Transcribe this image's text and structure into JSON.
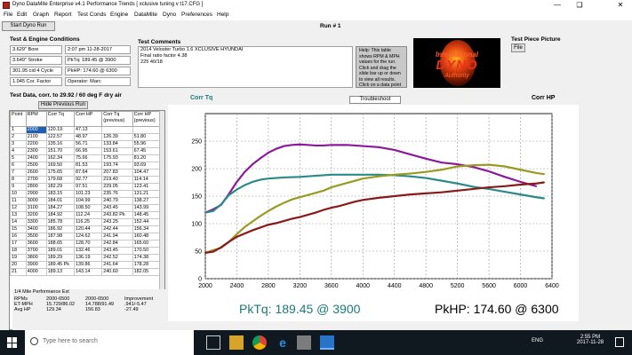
{
  "window": {
    "title": "Dyno DataMite Enterprise v4.1   Performance Trends  [ xclusive tuning v t17.CFG ]"
  },
  "menu": [
    "File",
    "Edit",
    "Graph",
    "Report",
    "Test Conds",
    "Engine",
    "DataMite",
    "Dyno",
    "Preferences",
    "Help"
  ],
  "toolbar": {
    "start_button": "Start Dyno Run",
    "run_label": "Run # 1"
  },
  "engine": {
    "title": "Test & Engine Conditions",
    "bore": "3.629\" Bore",
    "date": "2:07 pm  11-28-2017",
    "stroke": "3.649\" Stroke",
    "pktq": "PkTq: 189.45 @ 3900",
    "displacement": "301.95 cid  4 Cycle",
    "pkhp": "PkHP: 174.60 @ 6300",
    "corr_factor": "1.045 Cor. Factor",
    "operator": "Operator: Marc"
  },
  "comments": {
    "title": "Test Comments",
    "lines": [
      "2014 Veloster Turbo 1.6 XCLUSIVE  HYUNDAI",
      "Final ratio factor 4.38",
      "225 40/18"
    ]
  },
  "help": {
    "text": "Help:  This table shows RPM & MPH values for the run. Click and drag the slide bar up or down to view all results. Click on a data point"
  },
  "logo": {
    "line1": "International",
    "line2": "DYNO",
    "line3": "Authority"
  },
  "test_piece": {
    "title": "Test Piece Picture",
    "button": "File"
  },
  "test_data": {
    "title": "Test Data, corr. to 29.92 / 60 deg F dry air",
    "hide_button": "Hide Previous Run",
    "headers": [
      "Point",
      "RPM",
      "Corr Tq",
      "Corr HP",
      "Corr Tq (previous)",
      "Corr HP (previous)"
    ],
    "rows": [
      [
        "1",
        "2000",
        "120.19",
        "47.13",
        "",
        ""
      ],
      [
        "2",
        "2100",
        "122.57",
        "48.97",
        "126.39",
        "51.80"
      ],
      [
        "3",
        "2200",
        "135.16",
        "56.71",
        "133.84",
        "55.96"
      ],
      [
        "4",
        "2300",
        "151.70",
        "66.95",
        "153.61",
        "67.45"
      ],
      [
        "5",
        "2400",
        "162.34",
        "75.66",
        "175.93",
        "81.20"
      ],
      [
        "6",
        "2500",
        "169.50",
        "81.53",
        "193.74",
        "93.69"
      ],
      [
        "7",
        "2600",
        "175.65",
        "87.64",
        "207.83",
        "104.47"
      ],
      [
        "8",
        "2700",
        "179.68",
        "92.77",
        "219.40",
        "114.14"
      ],
      [
        "9",
        "2800",
        "182.29",
        "97.51",
        "229.05",
        "123.41"
      ],
      [
        "10",
        "2900",
        "183.15",
        "101.23",
        "235.76",
        "131.21"
      ],
      [
        "11",
        "3000",
        "184.01",
        "104.99",
        "240.79",
        "138.27"
      ],
      [
        "12",
        "3100",
        "184.27",
        "108.50",
        "243.45",
        "143.99"
      ],
      [
        "13",
        "3200",
        "184.92",
        "112.24",
        "243.82 Pk",
        "148.45"
      ],
      [
        "14",
        "3300",
        "185.78",
        "116.25",
        "243.25",
        "152.44"
      ],
      [
        "15",
        "3400",
        "186.92",
        "120.44",
        "242.44",
        "156.34"
      ],
      [
        "16",
        "3500",
        "187.98",
        "124.62",
        "241.94",
        "160.48"
      ],
      [
        "17",
        "3600",
        "188.65",
        "128.70",
        "242.84",
        "165.60"
      ],
      [
        "18",
        "3700",
        "189.01",
        "132.46",
        "243.45",
        "170.50"
      ],
      [
        "19",
        "3800",
        "189.29",
        "136.19",
        "242.52",
        "174.38"
      ],
      [
        "20",
        "3900",
        "189.45 Pk",
        "139.86",
        "241.64",
        "178.28"
      ],
      [
        "21",
        "4000",
        "189.13",
        "143.14",
        "240.60",
        "182.05"
      ]
    ]
  },
  "quarter_mile": {
    "title": "1/4 Mile Performance Est",
    "headers": [
      "RPMs",
      "2000-6500",
      "2000-6500",
      "Improvement"
    ],
    "rows": [
      [
        "ET-MPH",
        "15.729/86.02",
        "14.788/91.49",
        ".941/-5.47"
      ],
      [
        "Avg HP",
        "129.34",
        "156.83",
        "-27.49"
      ]
    ]
  },
  "graph": {
    "left_label": "Corr Tq",
    "troubleshoot": "Troubleshoot",
    "right_label": "Corr HP",
    "pktq": "PkTq: 189.45 @ 3900",
    "pkhp": "PkHP: 174.60 @ 6300"
  },
  "chart_data": {
    "type": "line",
    "xlim": [
      2000,
      6400
    ],
    "ylim": [
      0,
      300
    ],
    "x_ticks": [
      2000,
      2400,
      2800,
      3200,
      3600,
      4000,
      4400,
      4800,
      5200,
      5600,
      6000,
      6400
    ],
    "y_ticks": [
      0,
      50,
      100,
      150,
      200,
      250
    ],
    "series": [
      {
        "color": "#8a1a9a",
        "x": [
          2000,
          2100,
          2200,
          2300,
          2400,
          2500,
          2600,
          2700,
          2800,
          2900,
          3000,
          3100,
          3200,
          3300,
          3400,
          3500,
          3600,
          3700,
          3800,
          3900,
          4000,
          4200,
          4400,
          4600,
          4800,
          5000,
          5200,
          5400,
          5600,
          5800,
          6000,
          6200
        ],
        "y": [
          120,
          126,
          134,
          154,
          176,
          194,
          208,
          219,
          229,
          236,
          241,
          243,
          244,
          243,
          242,
          242,
          243,
          243,
          243,
          242,
          241,
          239,
          234,
          226,
          218,
          211,
          208,
          203,
          195,
          185,
          176,
          168
        ]
      },
      {
        "color": "#2a8a8a",
        "x": [
          2000,
          2100,
          2200,
          2300,
          2400,
          2500,
          2600,
          2700,
          2800,
          2900,
          3000,
          3200,
          3400,
          3600,
          3800,
          3900,
          4000,
          4200,
          4400,
          4600,
          4800,
          5000,
          5200,
          5400,
          5600,
          5800,
          6000,
          6200,
          6300
        ],
        "y": [
          120,
          123,
          135,
          152,
          162,
          170,
          176,
          180,
          182,
          183,
          184,
          185,
          187,
          189,
          189,
          189,
          189,
          189,
          188,
          186,
          183,
          178,
          173,
          167,
          163,
          158,
          153,
          148,
          146
        ]
      },
      {
        "color": "#9a9a22",
        "x": [
          2000,
          2100,
          2200,
          2300,
          2400,
          2500,
          2600,
          2700,
          2800,
          2900,
          3000,
          3100,
          3200,
          3300,
          3400,
          3500,
          3600,
          3700,
          3800,
          3900,
          4000,
          4200,
          4400,
          4600,
          4800,
          5000,
          5200,
          5400,
          5600,
          5800,
          6000,
          6200,
          6300
        ],
        "y": [
          47,
          52,
          56,
          67,
          81,
          94,
          104,
          114,
          123,
          131,
          138,
          144,
          148,
          152,
          156,
          160,
          166,
          170,
          174,
          178,
          182,
          186,
          189,
          191,
          194,
          198,
          204,
          206,
          207,
          204,
          198,
          192,
          190
        ]
      },
      {
        "color": "#8a1a1a",
        "x": [
          2000,
          2100,
          2200,
          2300,
          2400,
          2500,
          2600,
          2700,
          2800,
          2900,
          3000,
          3100,
          3200,
          3300,
          3400,
          3500,
          3600,
          3700,
          3800,
          3900,
          4000,
          4200,
          4400,
          4600,
          4800,
          5000,
          5200,
          5400,
          5600,
          5800,
          6000,
          6200,
          6300
        ],
        "y": [
          47,
          49,
          57,
          67,
          76,
          82,
          88,
          93,
          98,
          101,
          105,
          109,
          112,
          116,
          120,
          125,
          129,
          132,
          136,
          140,
          143,
          147,
          150,
          153,
          155,
          157,
          160,
          163,
          166,
          168,
          171,
          173,
          175
        ]
      }
    ]
  },
  "taskbar": {
    "search": "Type here to search",
    "time": "2:55 PM",
    "date": "2017-11-28",
    "lang": "ENG"
  }
}
